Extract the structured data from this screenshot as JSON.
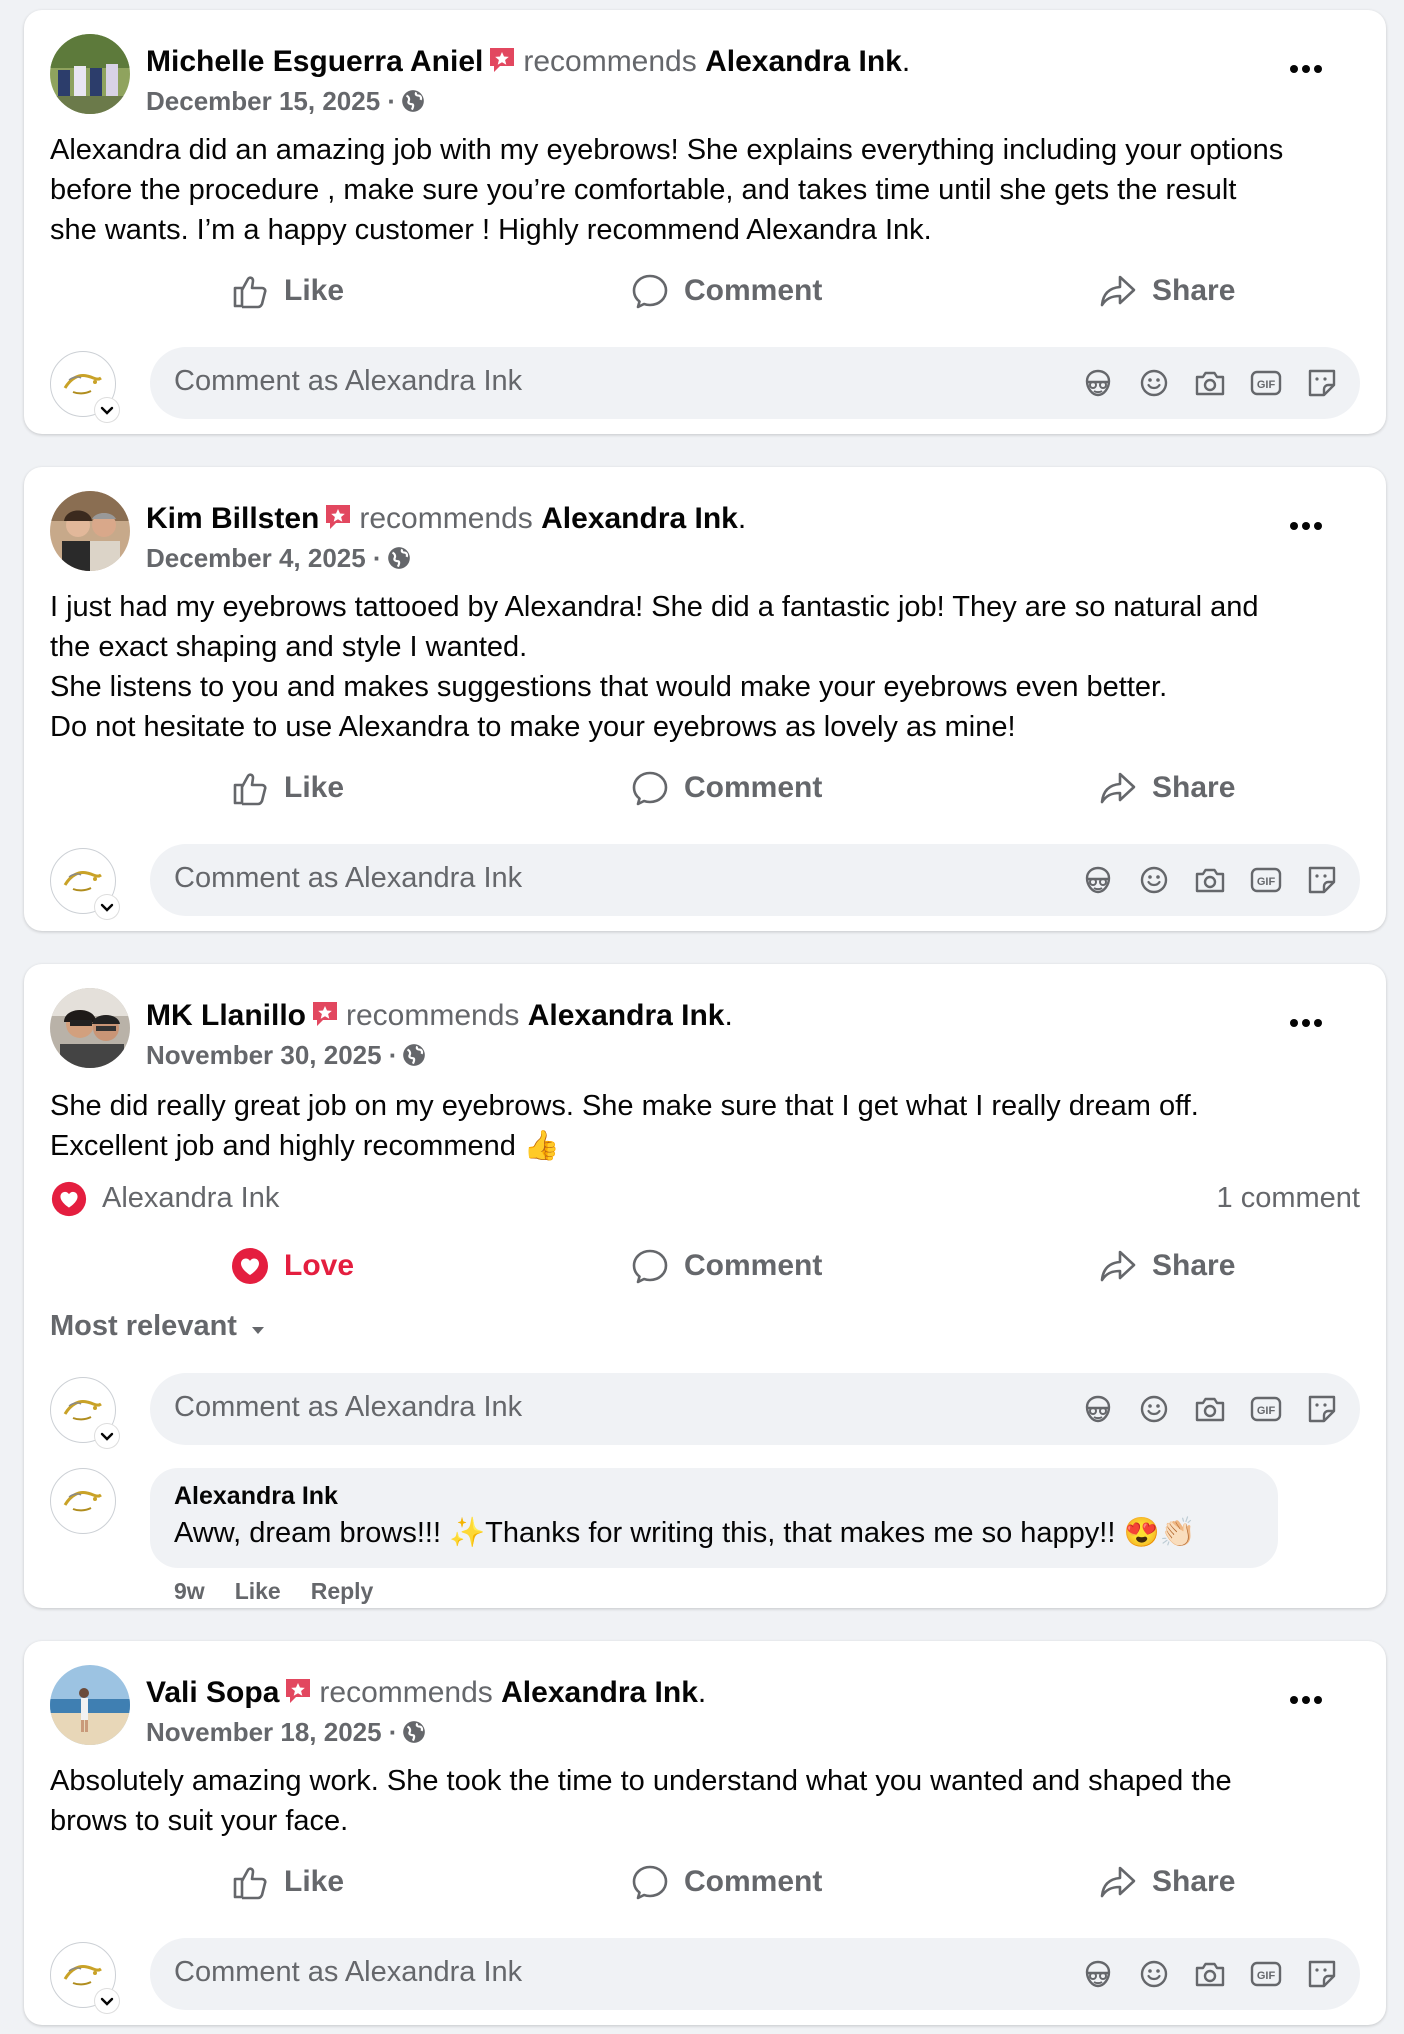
{
  "common": {
    "verb": "recommends",
    "page": "Alexandra Ink",
    "period": ".",
    "like": "Like",
    "love": "Love",
    "comment": "Comment",
    "share": "Share",
    "composer_placeholder": "Comment as Alexandra Ink",
    "icons": [
      "avatar-sticker-icon",
      "emoji-icon",
      "camera-icon",
      "gif-icon",
      "sticker-icon"
    ]
  },
  "posts": [
    {
      "author": "Michelle Esguerra Aniel",
      "date": "December 15, 2025 ·",
      "text": "Alexandra did an amazing job with my eyebrows! She explains everything including your options\nbefore the procedure , make sure you’re comfortable, and takes time until she gets the result\nshe wants. I’m a happy customer ! Highly recommend Alexandra Ink."
    },
    {
      "author": "Kim Billsten",
      "date": "December 4, 2025 ·",
      "text": "I just had my eyebrows tattooed by Alexandra! She did a fantastic job! They are so natural and\nthe exact shaping and style I wanted.\nShe listens to you and makes suggestions that would make your eyebrows even better.\nDo not hesitate to use Alexandra to make your eyebrows as lovely as mine!"
    },
    {
      "author": "MK Llanillo",
      "date": "November 30, 2025 ·",
      "text": "She did really great job on my eyebrows. She make sure that I get what I really dream off.\nExcellent job and highly recommend 👍",
      "reaction_by": "Alexandra Ink",
      "comment_count": "1 comment",
      "sort_label": "Most relevant",
      "reply": {
        "name": "Alexandra Ink",
        "text": "Aww, dream brows!!! ✨Thanks for writing this, that makes me so happy!! 😍👏🏻",
        "age": "9w",
        "like": "Like",
        "reply": "Reply"
      }
    },
    {
      "author": "Vali Sopa",
      "date": "November 18, 2025 ·",
      "text": "Absolutely amazing work. She took the time to understand what you wanted and shaped the\nbrows to suit your face."
    }
  ],
  "colors": {
    "background": "#f0f2f5",
    "muted": "#65676b",
    "love": "#e41e3f",
    "badge": "#e2475f"
  }
}
